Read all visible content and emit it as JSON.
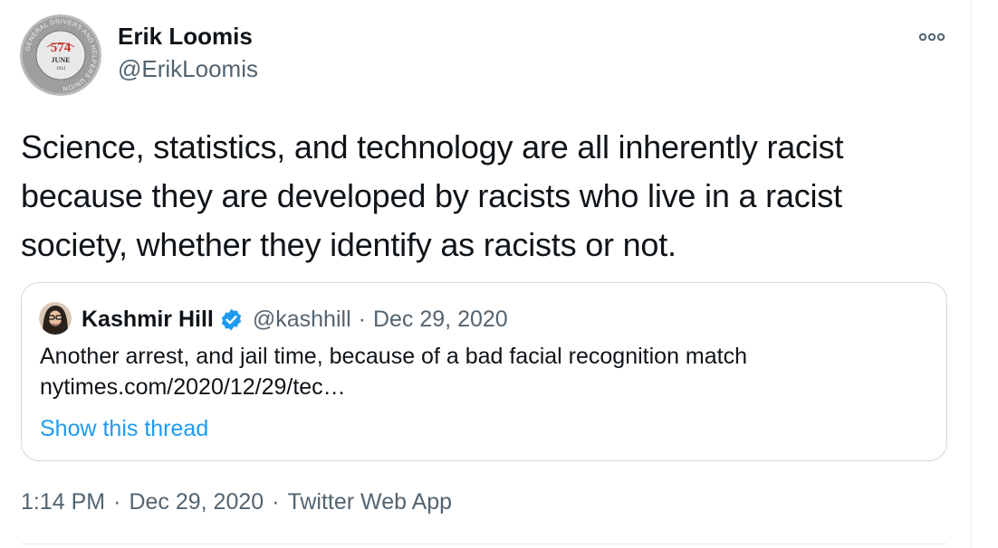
{
  "tweet": {
    "author": {
      "name": "Erik Loomis",
      "handle": "@ErikLoomis",
      "avatar_badge": {
        "number": "574",
        "month": "JUNE",
        "year": "1934",
        "ring_text": "GENERAL DRIVERS AND HELPERS UNION"
      }
    },
    "more_icon": "more-horizontal-icon",
    "text": "Science, statistics, and technology are all inherently racist because they are developed by racists who live in a racist society, whether they identify as racists or not.",
    "quoted": {
      "name": "Kashmir Hill",
      "verified_icon": "verified-badge-icon",
      "handle": "@kashhill",
      "separator": "·",
      "date": "Dec 29, 2020",
      "text": "Another arrest, and jail time, because of a bad facial recognition match",
      "link": "nytimes.com/2020/12/29/tec…",
      "show_thread": "Show this thread"
    },
    "meta": {
      "time": "1:14 PM",
      "sep1": "·",
      "date": "Dec 29, 2020",
      "sep2": "·",
      "source": "Twitter Web App"
    }
  },
  "colors": {
    "text": "#0f1419",
    "secondary": "#536471",
    "link": "#1d9bf0",
    "border": "#cfd9de",
    "badge_red": "#c0392b"
  }
}
